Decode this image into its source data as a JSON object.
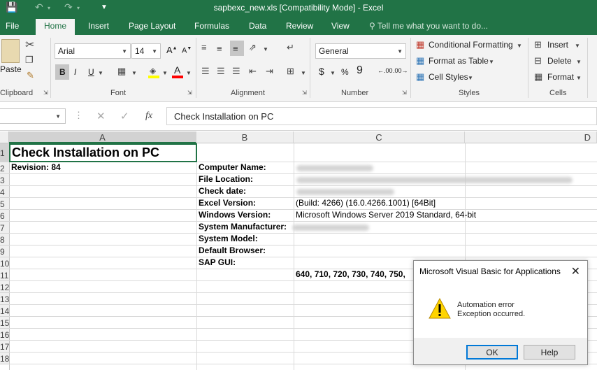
{
  "window": {
    "title": "sapbexc_new.xls  [Compatibility Mode] - Excel"
  },
  "ribbon_tabs": [
    "File",
    "Home",
    "Insert",
    "Page Layout",
    "Formulas",
    "Data",
    "Review",
    "View"
  ],
  "tell_me": "Tell me what you want to do...",
  "clipboard": {
    "paste": "Paste",
    "label": "Clipboard"
  },
  "font": {
    "name": "Arial",
    "size": "14",
    "label": "Font",
    "bold": "B",
    "italic": "I",
    "underline": "U"
  },
  "alignment": {
    "label": "Alignment"
  },
  "number": {
    "format": "General",
    "label": "Number",
    "currency": "$",
    "percent": "%",
    "comma": "9"
  },
  "styles": {
    "conditional": "Conditional Formatting",
    "table": "Format as Table",
    "cell_styles": "Cell Styles",
    "label": "Styles"
  },
  "cells": {
    "insert": "Insert",
    "delete": "Delete",
    "format": "Format",
    "label": "Cells"
  },
  "formula_bar": {
    "fx": "fx",
    "content": "Check Installation on PC"
  },
  "columns": [
    "A",
    "B",
    "C",
    "D"
  ],
  "rows": [
    "1",
    "2",
    "3",
    "4",
    "5",
    "6",
    "7",
    "8",
    "9",
    "10",
    "11",
    "12",
    "13",
    "14",
    "15",
    "16",
    "17",
    "18"
  ],
  "cells_data": {
    "a1": "Check Installation on PC",
    "a2": "Revision: 84",
    "b_labels": [
      "Computer Name:",
      "File Location:",
      "Check date:",
      "Excel Version:",
      "Windows Version:",
      "System Manufacturer:",
      "System Model:",
      "Default Browser:",
      "SAP GUI:"
    ],
    "c5": "(Build: 4266) (16.0.4266.1001) [64Bit]",
    "c6": "Microsoft Windows Server 2019 Standard, 64-bit",
    "c11": "640, 710, 720, 730, 740, 750,"
  },
  "dialog": {
    "title": "Microsoft Visual Basic for Applications",
    "line1": "Automation error",
    "line2": "Exception occurred.",
    "ok": "OK",
    "help": "Help"
  }
}
